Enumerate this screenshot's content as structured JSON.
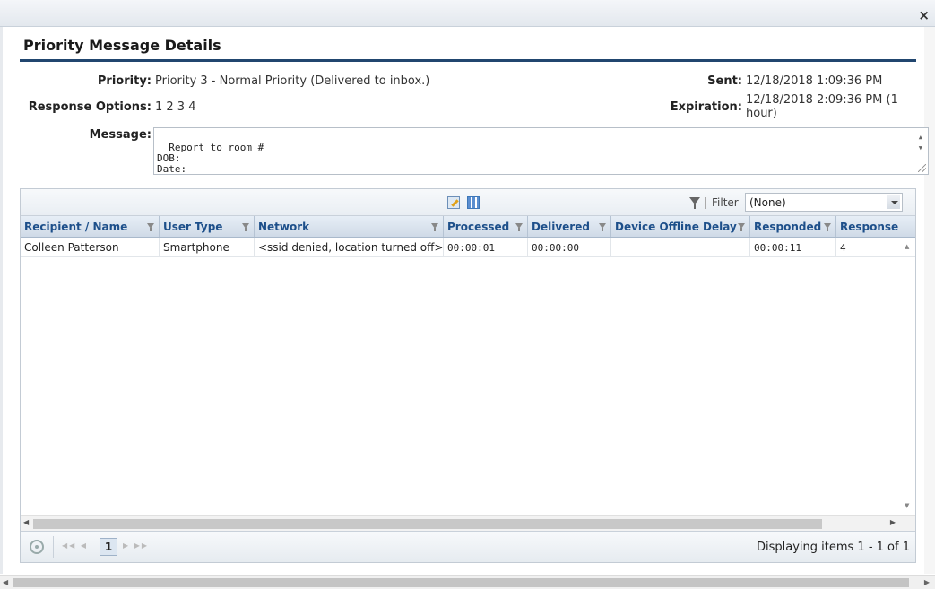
{
  "window": {
    "close_glyph": "×",
    "title": "Priority Message Details"
  },
  "details": {
    "priority_label": "Priority:",
    "priority_value": "Priority 3 - Normal Priority (Delivered to inbox.)",
    "response_options_label": "Response Options:",
    "response_options_value": "1 2 3 4",
    "message_label": "Message:",
    "message_value": "Report to room #\nDOB:\nDate:",
    "sent_label": "Sent:",
    "sent_value": "12/18/2018 1:09:36 PM",
    "expiration_label": "Expiration:",
    "expiration_value_line1": "12/18/2018 2:09:36 PM (1",
    "expiration_value_line2": "hour)"
  },
  "grid": {
    "toolbar": {
      "filter_label": "Filter",
      "filter_value": "(None)"
    },
    "columns": [
      "Recipient / Name",
      "User Type",
      "Network",
      "Processed",
      "Delivered",
      "Device Offline Delay",
      "Responded",
      "Response"
    ],
    "rows": [
      [
        "Colleen Patterson",
        "Smartphone",
        "<ssid denied, location turned off>",
        "00:00:01",
        "00:00:00",
        "",
        "00:00:11",
        "4"
      ]
    ],
    "pager": {
      "current_page": "1",
      "info": "Displaying items 1 - 1 of 1"
    }
  }
}
